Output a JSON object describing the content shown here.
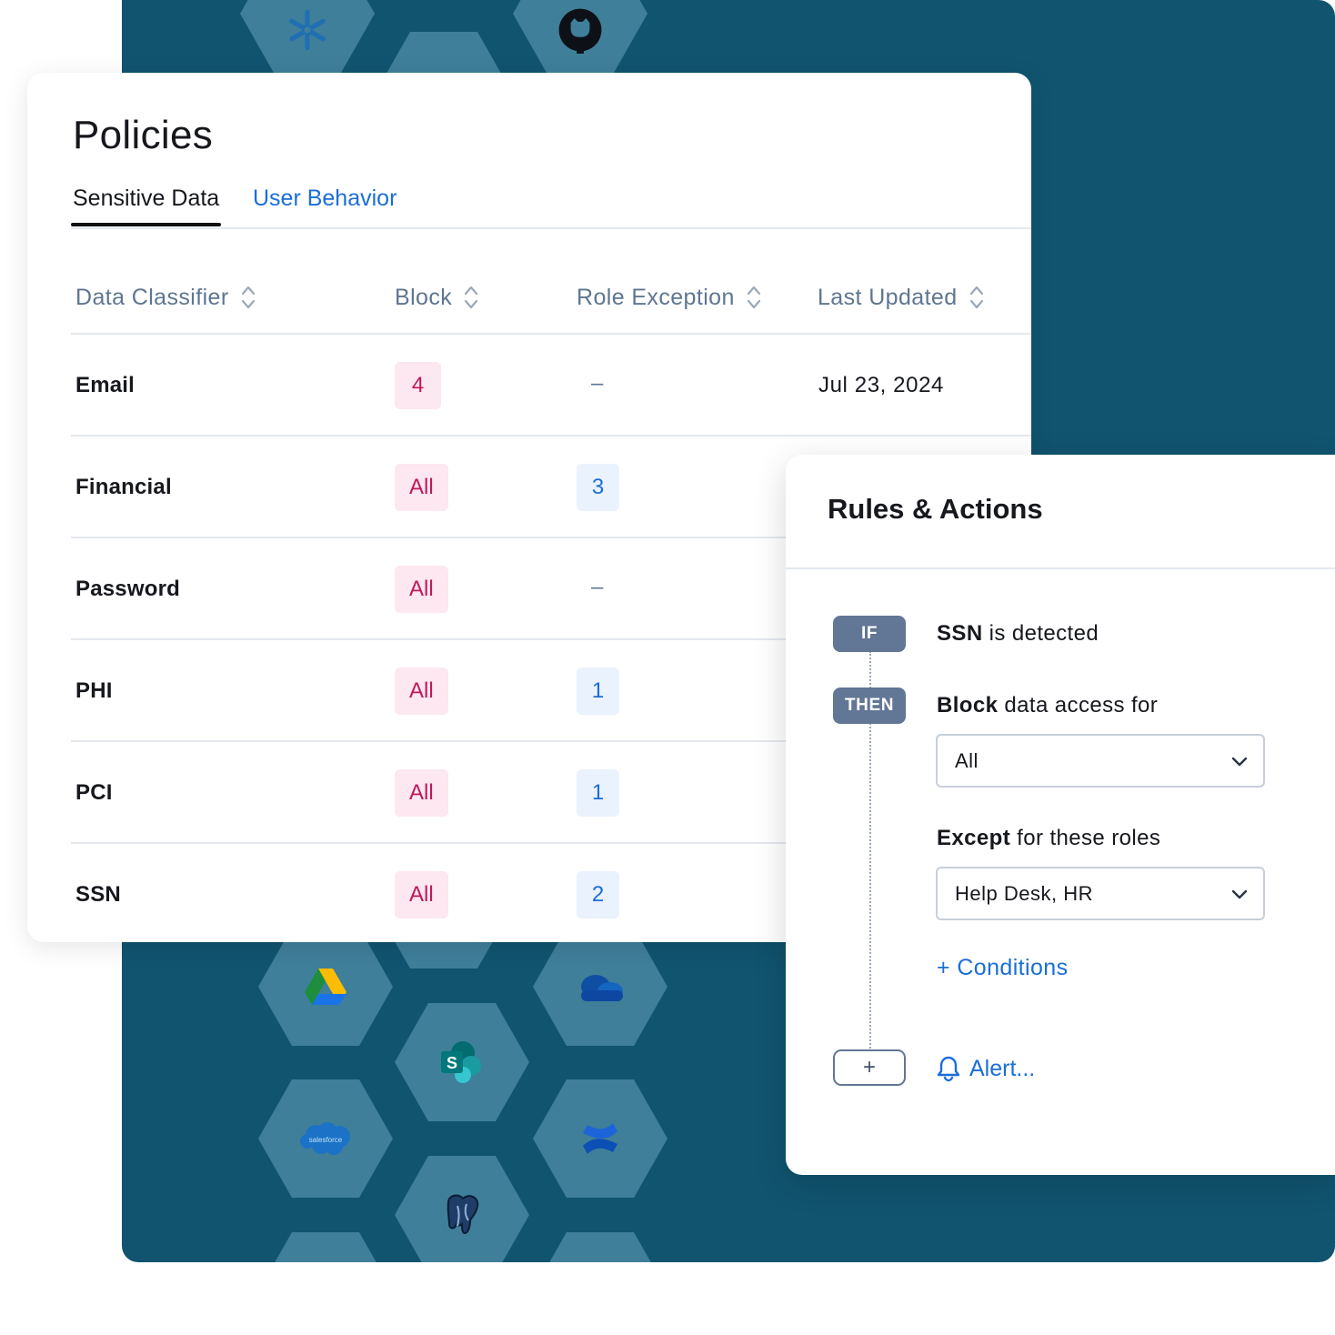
{
  "policies": {
    "title": "Policies",
    "tabs": [
      {
        "label": "Sensitive Data",
        "active": true
      },
      {
        "label": "User Behavior",
        "active": false
      }
    ],
    "columns": [
      "Data Classifier",
      "Block",
      "Role Exception",
      "Last Updated"
    ],
    "rows": [
      {
        "classifier": "Email",
        "block": "4",
        "role_exception": "–",
        "last_updated": "Jul 23, 2024"
      },
      {
        "classifier": "Financial",
        "block": "All",
        "role_exception": "3",
        "last_updated": ""
      },
      {
        "classifier": "Password",
        "block": "All",
        "role_exception": "–",
        "last_updated": ""
      },
      {
        "classifier": "PHI",
        "block": "All",
        "role_exception": "1",
        "last_updated": ""
      },
      {
        "classifier": "PCI",
        "block": "All",
        "role_exception": "1",
        "last_updated": ""
      },
      {
        "classifier": "SSN",
        "block": "All",
        "role_exception": "2",
        "last_updated": ""
      }
    ]
  },
  "rules": {
    "title": "Rules & Actions",
    "if_label": "IF",
    "then_label": "THEN",
    "if_condition_bold": "SSN",
    "if_condition_rest": " is detected",
    "then_action_bold": "Block",
    "then_action_rest": " data access for",
    "block_select_value": "All",
    "except_bold": "Except",
    "except_rest": " for these roles",
    "except_select_value": "Help Desk, HR",
    "conditions_link": "+ Conditions",
    "add_button": "+",
    "alert_link": "Alert..."
  },
  "integrations": [
    "snowflake-icon",
    "github-icon",
    "google-drive-icon",
    "onedrive-icon",
    "sharepoint-icon",
    "salesforce-icon",
    "confluence-icon",
    "postgresql-icon"
  ],
  "colors": {
    "backdrop": "#11546f",
    "hexagon": "#3f7f99",
    "accent_blue": "#1a6ed8",
    "block_badge_bg": "#fde7f0",
    "block_badge_text": "#c0185b",
    "exception_badge_bg": "#eaf2fd",
    "pill_bg": "#627695"
  }
}
